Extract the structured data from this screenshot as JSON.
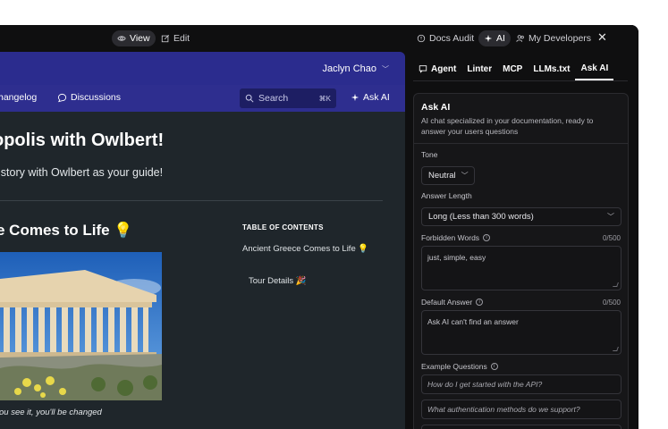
{
  "topbar": {
    "view_label": "View",
    "edit_label": "Edit",
    "docs_audit_label": "Docs Audit",
    "ai_label": "AI",
    "developers_label": "My Developers",
    "close_label": "✕"
  },
  "preview": {
    "user_name": "Jaclyn Chao",
    "nav": {
      "changelog_label": "hangelog",
      "discussions_label": "Discussions",
      "search_placeholder": "Search",
      "search_shortcut": "⌘K",
      "ask_ai_label": "Ask AI"
    },
    "hero_title": "opolis with Owlbert!",
    "hero_subtitle": "istory with Owlbert as your guide!",
    "section_title": "e Comes to Life 💡",
    "caption": "ou see it, you'll be changed",
    "toc": {
      "heading": "TABLE OF CONTENTS",
      "items": [
        "Ancient Greece Comes to Life 💡",
        "Tour Details 🎉"
      ]
    }
  },
  "panel_tabs": [
    "Agent",
    "Linter",
    "MCP",
    "LLMs.txt",
    "Ask AI"
  ],
  "ask_ai": {
    "title": "Ask AI",
    "description": "AI chat specialized in your documentation, ready to answer your users questions",
    "tone_label": "Tone",
    "tone_value": "Neutral",
    "answer_length_label": "Answer Length",
    "answer_length_value": "Long (Less than 300 words)",
    "forbidden_words_label": "Forbidden Words",
    "forbidden_words_count": "0/500",
    "forbidden_words_value": "just, simple, easy",
    "default_answer_label": "Default Answer",
    "default_answer_count": "0/500",
    "default_answer_value": "Ask AI can't find an answer",
    "example_questions_label": "Example Questions",
    "example_questions": [
      "How do I get started with the API?",
      "What authentication methods do we support?"
    ]
  },
  "colors": {
    "brand_nav": "#2b2c8e",
    "preview_bg": "#1f262b",
    "app_bg": "#0f0f10"
  }
}
